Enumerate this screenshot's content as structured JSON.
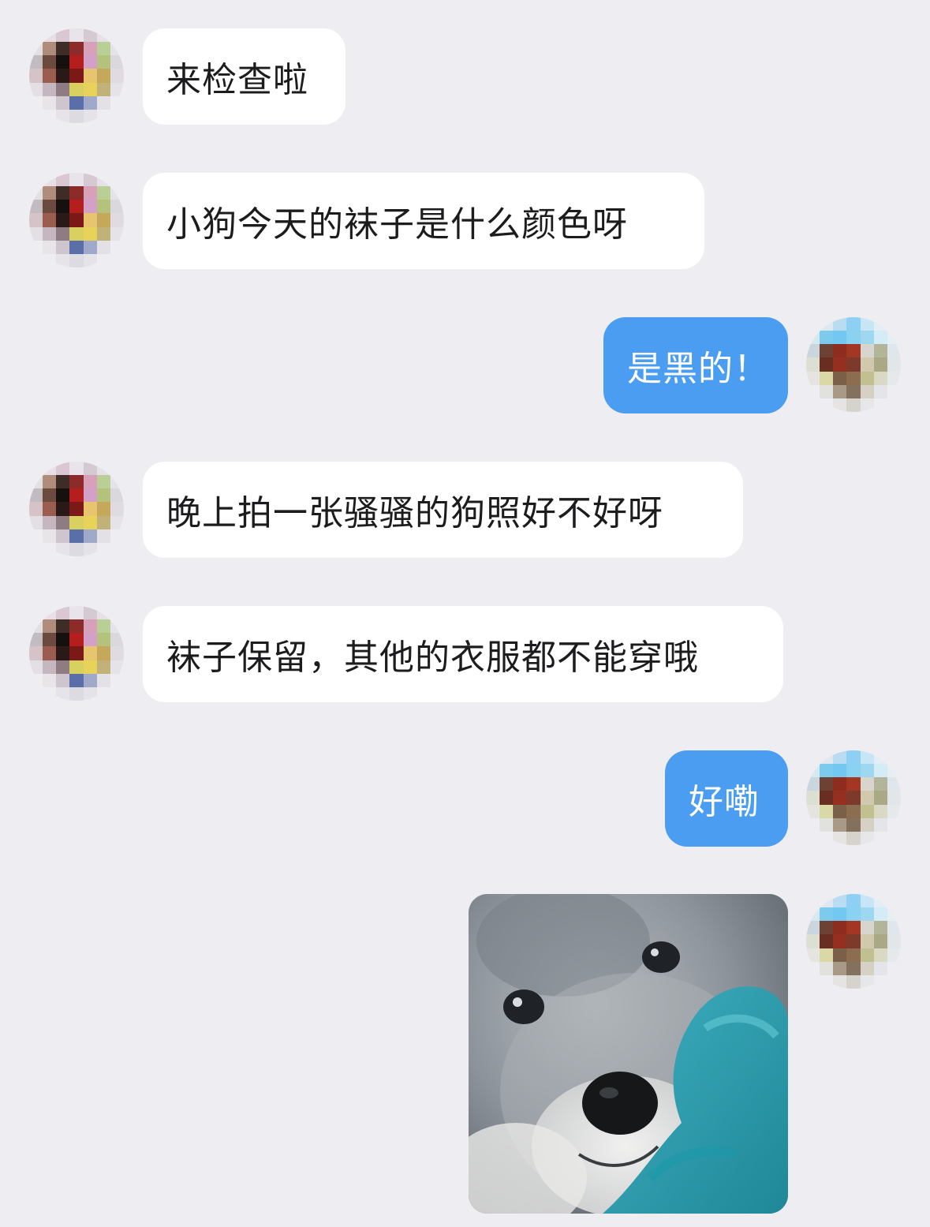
{
  "conversation": {
    "messages": [
      {
        "side": "in",
        "text": "来检查啦"
      },
      {
        "side": "in",
        "text": "小狗今天的袜子是什么颜色呀"
      },
      {
        "side": "out",
        "text": "是黑的！"
      },
      {
        "side": "in",
        "text": "晚上拍一张骚骚的狗照好不好呀"
      },
      {
        "side": "in",
        "text": "袜子保留，其他的衣服都不能穿哦"
      },
      {
        "side": "out",
        "text": "好嘞"
      },
      {
        "side": "out",
        "type": "image",
        "subject": "puppy-photo"
      }
    ]
  },
  "colors": {
    "background": "#ededf2",
    "incoming_bubble": "#ffffff",
    "outgoing_bubble": "#4a9df0",
    "text_dark": "#1c1c1e",
    "text_light": "#ffffff"
  },
  "icons": {
    "contact_avatar": "pixelated-avatar-icon",
    "self_avatar": "pixelated-avatar-icon"
  }
}
